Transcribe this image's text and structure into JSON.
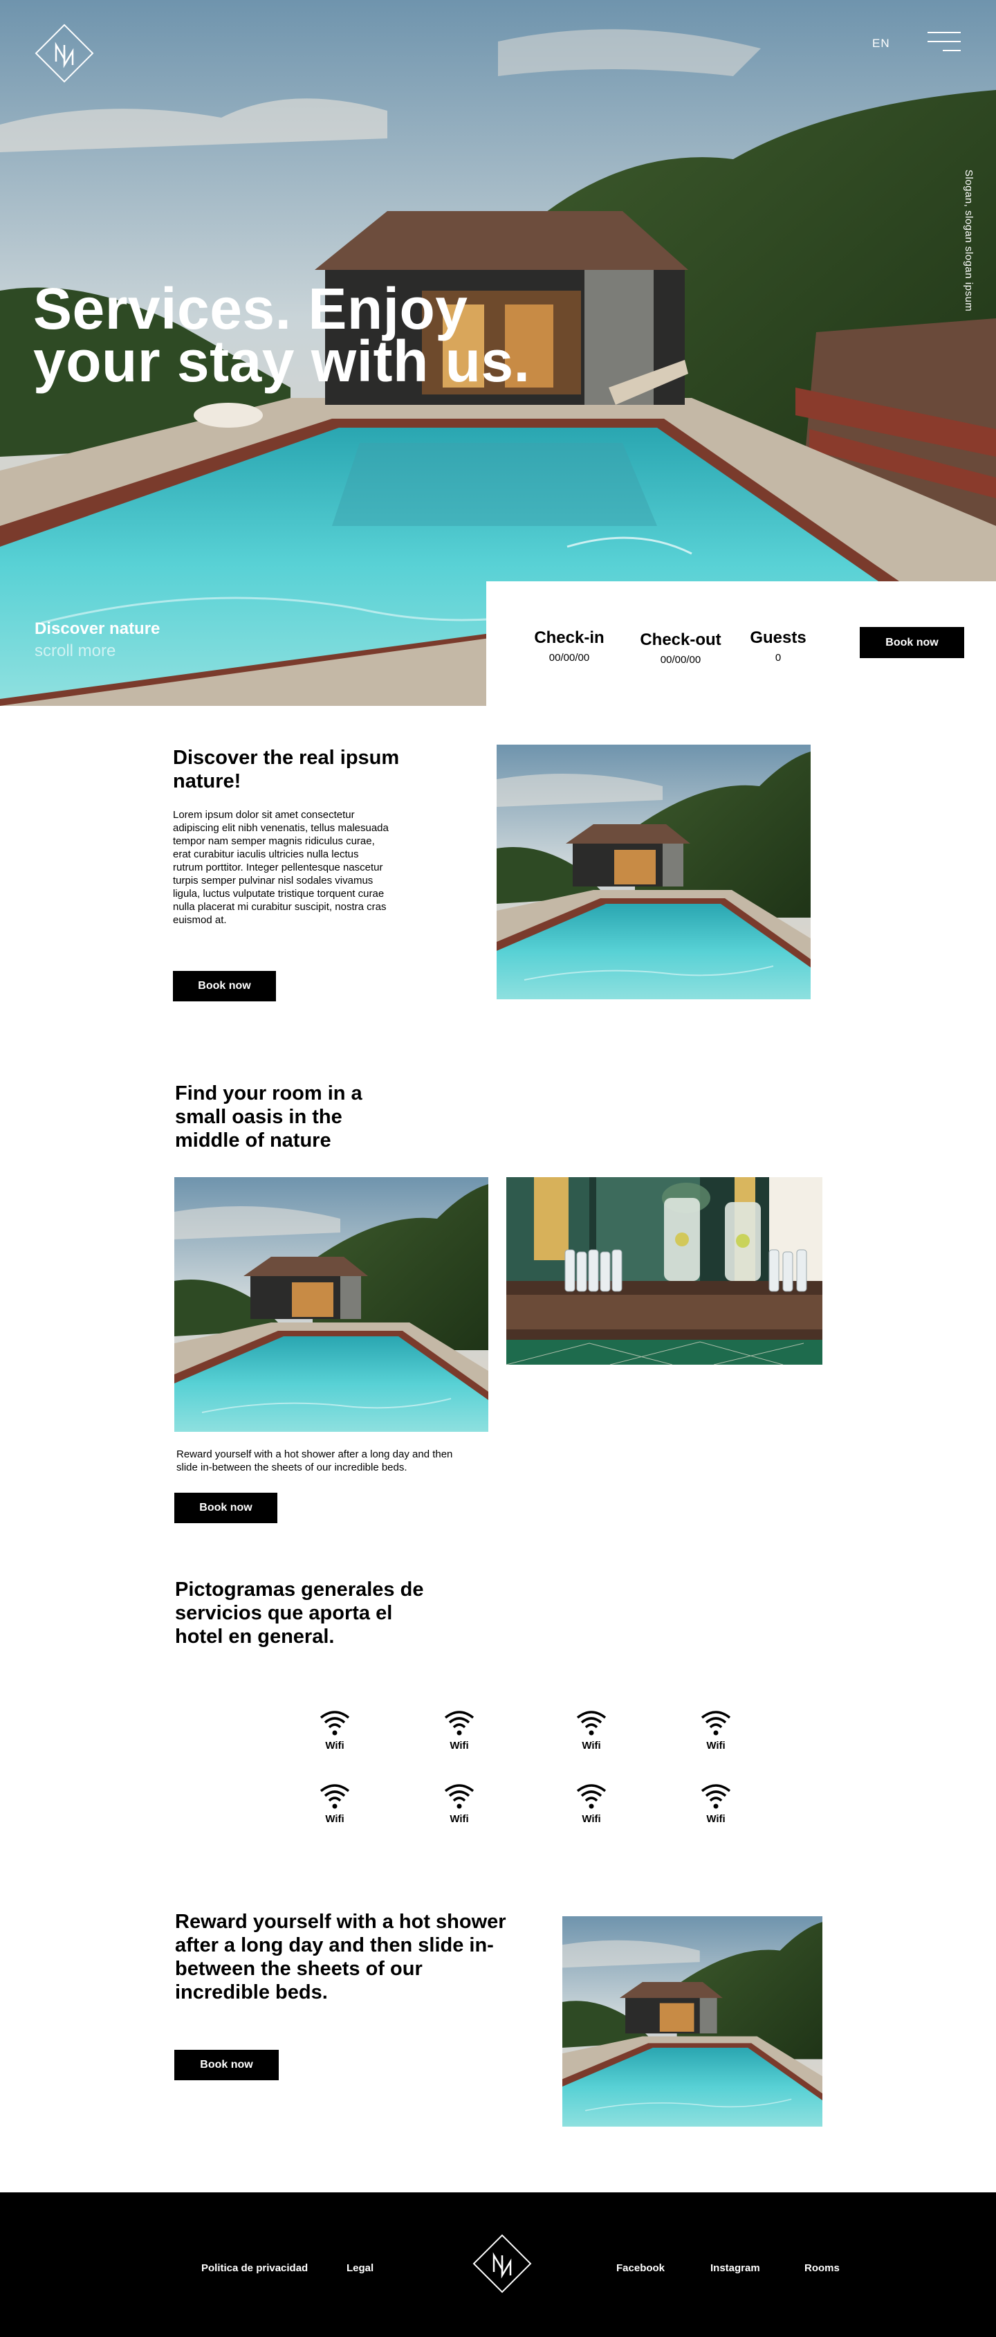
{
  "header": {
    "lang": "EN",
    "slogan": "Slogan, slogan slogan ipsum"
  },
  "hero": {
    "title_line1": "Services. Enjoy",
    "title_line2": "your stay with us.",
    "discover": "Discover nature",
    "scroll": "scroll more"
  },
  "booking": {
    "checkin_label": "Check-in",
    "checkin_value": "00/00/00",
    "checkout_label": "Check-out",
    "checkout_value": "00/00/00",
    "guests_label": "Guests",
    "guests_value": "0",
    "button": "Book now"
  },
  "section1": {
    "title": "Discover the real ipsum nature!",
    "body": "Lorem ipsum dolor sit amet consectetur adipiscing elit nibh venenatis, tellus malesuada tempor nam semper magnis ridiculus curae, erat curabitur iaculis ultricies nulla lectus rutrum porttitor. Integer pellentesque nascetur turpis semper pulvinar nisl sodales vivamus ligula, luctus vulputate tristique torquent curae nulla placerat mi curabitur suscipit, nostra cras euismod at.",
    "button": "Book now"
  },
  "section2": {
    "title": "Find your room in a small oasis in the middle of nature",
    "text": "Reward yourself with a hot shower after a long day and then slide in-between the sheets of our incredible beds.",
    "button": "Book now"
  },
  "section3": {
    "title": "Pictogramas generales de servicios que aporta el hotel en general.",
    "pictograms": [
      {
        "icon": "wifi-icon",
        "label": "Wifi"
      },
      {
        "icon": "wifi-icon",
        "label": "Wifi"
      },
      {
        "icon": "wifi-icon",
        "label": "Wifi"
      },
      {
        "icon": "wifi-icon",
        "label": "Wifi"
      },
      {
        "icon": "wifi-icon",
        "label": "Wifi"
      },
      {
        "icon": "wifi-icon",
        "label": "Wifi"
      },
      {
        "icon": "wifi-icon",
        "label": "Wifi"
      },
      {
        "icon": "wifi-icon",
        "label": "Wifi"
      }
    ]
  },
  "section4": {
    "title": "Reward yourself with a hot shower after a long day and then slide in-between the sheets of our incredible beds.",
    "button": "Book now"
  },
  "footer": {
    "privacy": "Politica de privacidad",
    "legal": "Legal",
    "facebook": "Facebook",
    "instagram": "Instagram",
    "rooms": "Rooms"
  },
  "colors": {
    "accent": "#000000",
    "pool": "#3fc4c9",
    "background": "#ffffff"
  }
}
